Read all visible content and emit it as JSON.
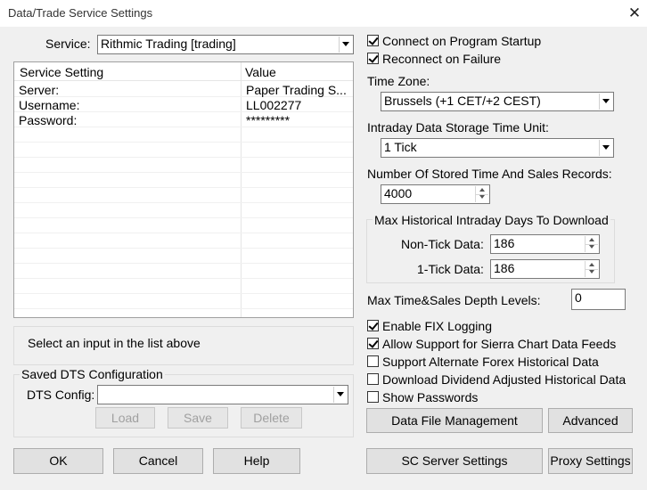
{
  "window": {
    "title": "Data/Trade Service Settings",
    "close_glyph": "✕"
  },
  "service": {
    "label": "Service:",
    "value": "Rithmic Trading   [trading]"
  },
  "settings_list": {
    "columns": [
      "Service Setting",
      "Value"
    ],
    "rows": [
      {
        "setting": "Server:",
        "value": "Paper Trading S..."
      },
      {
        "setting": "Username:",
        "value": "LL002277"
      },
      {
        "setting": "Password:",
        "value": "*********"
      }
    ]
  },
  "message": "Select an input in the list above",
  "dts": {
    "group_title": "Saved DTS Configuration",
    "config_label": "DTS Config:",
    "config_value": "",
    "load_label": "Load",
    "save_label": "Save",
    "delete_label": "Delete"
  },
  "options": {
    "connect_on_startup": {
      "label": "Connect on Program Startup",
      "checked": true
    },
    "reconnect_on_failure": {
      "label": "Reconnect on Failure",
      "checked": true
    }
  },
  "time_zone": {
    "label": "Time Zone:",
    "value": "Brussels (+1 CET/+2 CEST)"
  },
  "intraday_unit": {
    "label": "Intraday Data Storage Time Unit:",
    "value": "1 Tick"
  },
  "stored_records": {
    "label": "Number Of Stored Time And Sales Records:",
    "value": "4000"
  },
  "historical": {
    "group_title": "Max Historical Intraday Days To Download",
    "non_tick_label": "Non-Tick Data:",
    "non_tick_value": "186",
    "one_tick_label": "1-Tick Data:",
    "one_tick_value": "186"
  },
  "depth_levels": {
    "label": "Max Time&Sales Depth Levels:",
    "value": "0"
  },
  "checks": {
    "fix_logging": {
      "label": "Enable FIX Logging",
      "checked": true
    },
    "sierra_feeds": {
      "label": "Allow Support for Sierra Chart Data Feeds",
      "checked": true
    },
    "forex_historical": {
      "label": "Support Alternate Forex Historical Data",
      "checked": false
    },
    "dividend_adjusted": {
      "label": "Download Dividend Adjusted Historical Data",
      "checked": false
    },
    "show_passwords": {
      "label": "Show Passwords",
      "checked": false
    }
  },
  "buttons": {
    "data_file_management": "Data File Management",
    "advanced": "Advanced",
    "ok": "OK",
    "cancel": "Cancel",
    "help": "Help",
    "sc_server_settings": "SC Server Settings",
    "proxy_settings": "Proxy Settings"
  }
}
